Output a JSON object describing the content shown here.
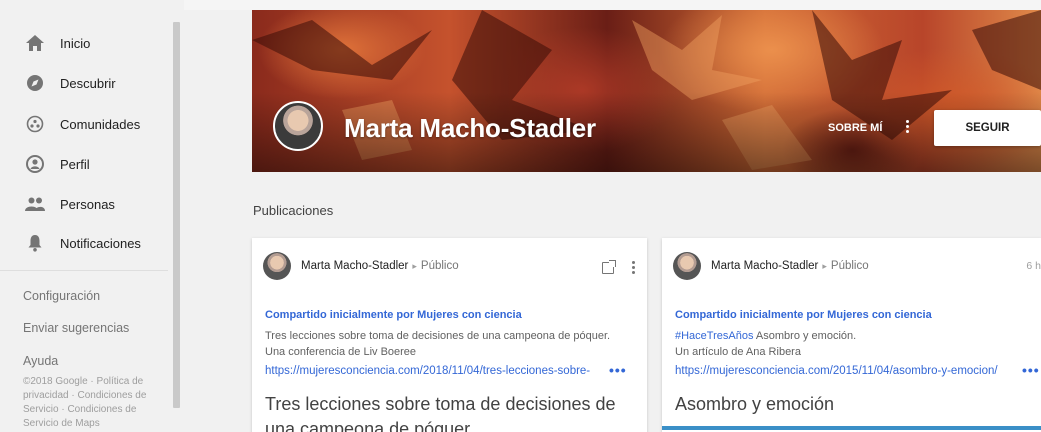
{
  "sidebar": {
    "items": [
      {
        "label": "Inicio",
        "icon": "home-icon"
      },
      {
        "label": "Descubrir",
        "icon": "compass-icon"
      },
      {
        "label": "Comunidades",
        "icon": "communities-icon"
      },
      {
        "label": "Perfil",
        "icon": "profile-icon"
      },
      {
        "label": "Personas",
        "icon": "people-icon"
      },
      {
        "label": "Notificaciones",
        "icon": "bell-icon"
      }
    ],
    "settings": "Configuración",
    "feedback": "Enviar sugerencias",
    "help": "Ayuda",
    "legal": "©2018 Google · Política de privacidad · Condiciones de Servicio · Condiciones de Servicio de Maps"
  },
  "profile": {
    "name": "Marta Macho-Stadler",
    "about_label": "SOBRE MÍ",
    "follow_label": "SEGUIR"
  },
  "section_title": "Publicaciones",
  "posts": [
    {
      "author": "Marta Macho-Stadler",
      "visibility": "Público",
      "time": "",
      "shared": "Compartido inicialmente por Mujeres con ciencia",
      "line1": "Tres lecciones sobre toma de decisiones de una campeona de póquer.",
      "line2": "Una conferencia de Liv Boeree",
      "url": "https://mujeresconciencia.com/2018/11/04/tres-lecciones-sobre-",
      "title": "Tres lecciones sobre toma de decisiones de una campeona de póquer"
    },
    {
      "author": "Marta Macho-Stadler",
      "visibility": "Público",
      "time": "6 h",
      "shared": "Compartido inicialmente por Mujeres con ciencia",
      "hashtag": "#HaceTresAños",
      "line1_rest": " Asombro y emoción.",
      "line2": "Un artículo de Ana Ribera",
      "url": "https://mujeresconciencia.com/2015/11/04/asombro-y-emocion/",
      "title": "Asombro y emoción"
    }
  ],
  "colors": {
    "link": "#3367d6",
    "background": "#f1f1f1"
  }
}
